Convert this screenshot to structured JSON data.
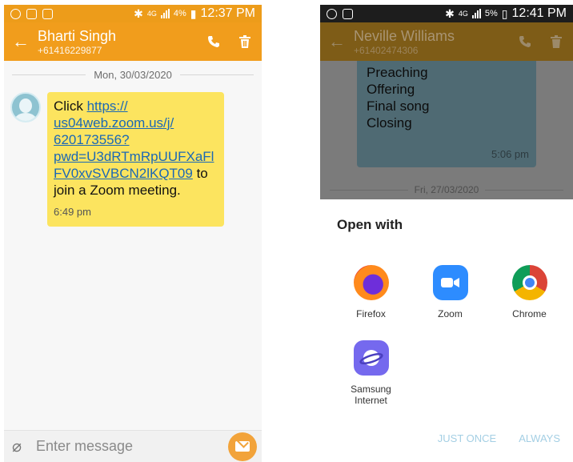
{
  "left": {
    "status": {
      "battery": "4%",
      "network": "4G",
      "time": "12:37 PM"
    },
    "contact": {
      "name": "Bharti Singh",
      "number": "+61416229877"
    },
    "date": "Mon, 30/03/2020",
    "message": {
      "prefix": "Click ",
      "link": "https:// us04web.zoom.us/j/ 620173556? pwd=U3dRTmRpUUFXaFl FV0xvSVBCN2lKQT09",
      "suffix": " to join a Zoom meeting.",
      "time": "6:49 pm"
    },
    "composer_placeholder": "Enter message"
  },
  "right": {
    "status": {
      "battery": "5%",
      "network": "4G",
      "time": "12:41 PM"
    },
    "contact": {
      "name": "Neville Williams",
      "number": "+61402474306"
    },
    "bg_message_lines": [
      "Preaching",
      "Offering",
      "Final song",
      "Closing"
    ],
    "bg_message_time": "5:06 pm",
    "bg_date": "Fri, 27/03/2020",
    "sheet": {
      "title": "Open with",
      "apps": [
        {
          "label": "Firefox",
          "icon": "firefox-icon"
        },
        {
          "label": "Zoom",
          "icon": "zoom-icon"
        },
        {
          "label": "Chrome",
          "icon": "chrome-icon"
        },
        {
          "label": "Samsung Internet",
          "icon": "samsung-internet-icon"
        }
      ],
      "just_once": "JUST ONCE",
      "always": "ALWAYS"
    }
  },
  "colors": {
    "orange": "#f19d1c",
    "bubble": "#fce45f",
    "link": "#1b68b5"
  }
}
